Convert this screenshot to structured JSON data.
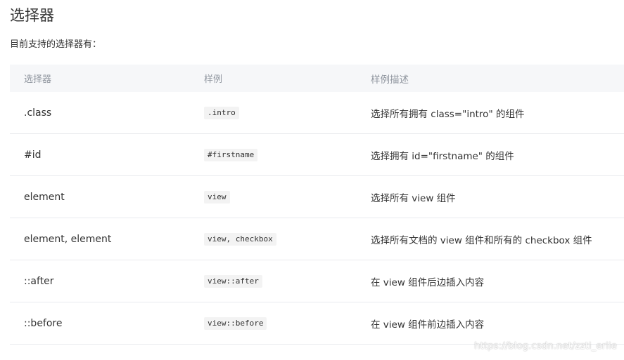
{
  "page": {
    "title": "选择器",
    "intro": "目前支持的选择器有："
  },
  "table": {
    "headers": [
      "选择器",
      "样例",
      "样例描述"
    ],
    "rows": [
      {
        "selector": ".class",
        "example": ".intro",
        "description": "选择所有拥有 class=\"intro\" 的组件"
      },
      {
        "selector": "#id",
        "example": "#firstname",
        "description": "选择拥有 id=\"firstname\" 的组件"
      },
      {
        "selector": "element",
        "example": "view",
        "description": "选择所有 view 组件"
      },
      {
        "selector": "element, element",
        "example": "view, checkbox",
        "description": "选择所有文档的 view 组件和所有的 checkbox 组件"
      },
      {
        "selector": "::after",
        "example": "view::after",
        "description": "在 view 组件后边插入内容"
      },
      {
        "selector": "::before",
        "example": "view::before",
        "description": "在 view 组件前边插入内容"
      }
    ]
  },
  "watermark": "https://blog.csdn.net/zzti_erlie"
}
